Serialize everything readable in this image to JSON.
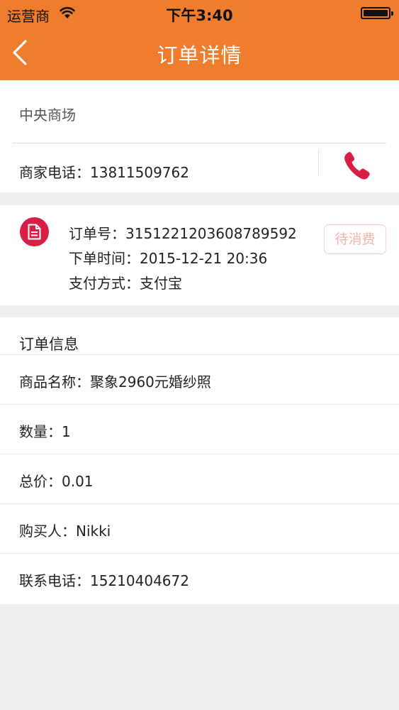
{
  "status_bar": {
    "carrier": "运营商",
    "time": "下午3:40"
  },
  "nav": {
    "title": "订单详情"
  },
  "merchant": {
    "name": "中央商场",
    "phone": "商家电话：13811509762"
  },
  "order": {
    "number": "订单号：3151221203608789592",
    "time": "下单时间：2015-12-21 20:36",
    "payment": "支付方式：支付宝",
    "status": "待消费"
  },
  "info": {
    "header": "订单信息",
    "rows": [
      "商品名称：聚象2960元婚纱照",
      "数量：1",
      "总价：0.01",
      "购买人：Nikki",
      "联系电话：15210404672"
    ]
  },
  "colors": {
    "brand": "#f07d2d",
    "accent_red": "#d71e45",
    "status_tag": "#f4b6a8"
  }
}
